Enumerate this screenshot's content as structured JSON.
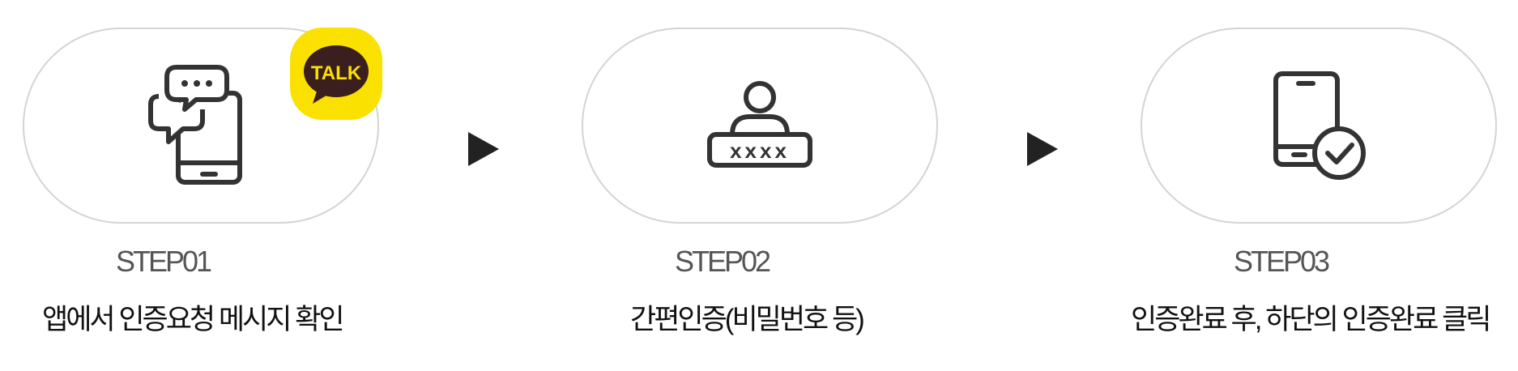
{
  "steps": [
    {
      "label": "STEP01",
      "description": "앱에서 인증요청 메시지 확인",
      "icon": "chat-phone-icon",
      "badge": {
        "text": "TALK",
        "icon": "kakaotalk-icon",
        "color": "#fae100"
      }
    },
    {
      "label": "STEP02",
      "description": "간편인증(비밀번호 등)",
      "icon": "user-password-icon",
      "password_mask": "xxxx"
    },
    {
      "label": "STEP03",
      "description": "인증완료 후, 하단의 인증완료 클릭",
      "icon": "phone-check-icon"
    }
  ],
  "arrows": [
    {
      "icon": "arrow-right-icon"
    },
    {
      "icon": "arrow-right-icon"
    }
  ],
  "colors": {
    "pill_border": "#d4d4d4",
    "icon_stroke": "#333333",
    "kakao_yellow": "#fae100",
    "kakao_brown": "#3b1e1e"
  }
}
